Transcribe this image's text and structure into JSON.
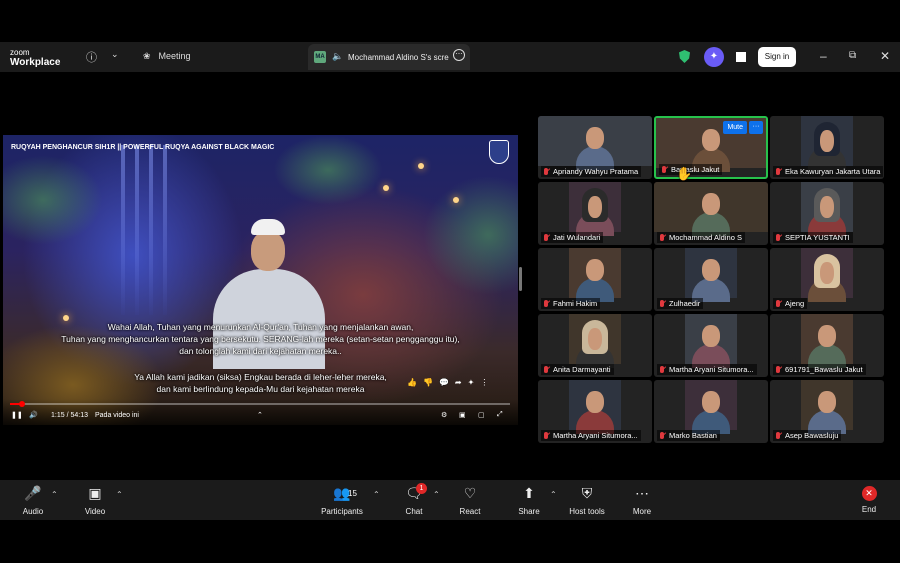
{
  "app": {
    "brand_line1": "zoom",
    "brand_line2": "Workplace"
  },
  "topbar": {
    "info_icon": "info-icon",
    "meeting_label": "Meeting",
    "share_tab_badge": "MA",
    "share_tab_title": "Mochammad Aldino S's scre",
    "sign_in_label": "Sign in"
  },
  "video": {
    "title": "RUQYAH PENGHANCUR SIH1R || POWERFUL RUQYA AGAINST BLACK MAGIC",
    "subtitle_block1": [
      "Wahai Allah, Tuhan yang menurunkan Al-Qur'an, Tuhan yang menjalankan awan,",
      "Tuhan yang menghancurkan tentara yang bersekutu. SERANG-lah mereka (setan-setan pengganggu itu),",
      "dan tolonglah kami dari kejahatan mereka.."
    ],
    "subtitle_block2": [
      "Ya Allah kami jadikan (siksa) Engkau berada di leher-leher mereka,",
      "dan kami berlindung kepada-Mu dari kejahatan mereka"
    ],
    "time": "1:15 / 54:13",
    "chapter": "Pada video ini",
    "progress_fraction": 0.023
  },
  "participants": [
    {
      "name": "Apriandy Wahyu Pratama",
      "muted": true
    },
    {
      "name": "Bawaslu Jakut",
      "muted": true,
      "hover": true
    },
    {
      "name": "Eka Kawuryan Jakarta Utara",
      "muted": true
    },
    {
      "name": "Jati Wulandari",
      "muted": true
    },
    {
      "name": "Mochammad Aldino S",
      "muted": true
    },
    {
      "name": "SEPTIA YUSTANTI",
      "muted": true
    },
    {
      "name": "Fahmi Hakim",
      "muted": true
    },
    {
      "name": "Zulhaedir",
      "muted": true
    },
    {
      "name": "Ajeng",
      "muted": true
    },
    {
      "name": "Anita Darmayanti",
      "muted": true
    },
    {
      "name": "Martha Aryani Situmora...",
      "muted": true
    },
    {
      "name": "691791_Bawaslu Jakut",
      "muted": true
    },
    {
      "name": "Martha Aryani Situmora...",
      "muted": true
    },
    {
      "name": "Marko Bastian",
      "muted": true
    },
    {
      "name": "Asep Bawasluju",
      "muted": true
    }
  ],
  "hover_controls": {
    "mute_label": "Mute",
    "more_label": "···"
  },
  "toolbar": {
    "audio": "Audio",
    "video": "Video",
    "participants": "Participants",
    "participants_count": "15",
    "chat": "Chat",
    "chat_badge": "1",
    "react": "React",
    "share": "Share",
    "host_tools": "Host tools",
    "more": "More",
    "end": "End"
  },
  "colors": {
    "accent_blue": "#0e71eb",
    "active_speaker": "#27c24c",
    "end_red": "#e02828",
    "shield_green": "#2fbf71",
    "ai_purple": "#6a5cf6"
  }
}
